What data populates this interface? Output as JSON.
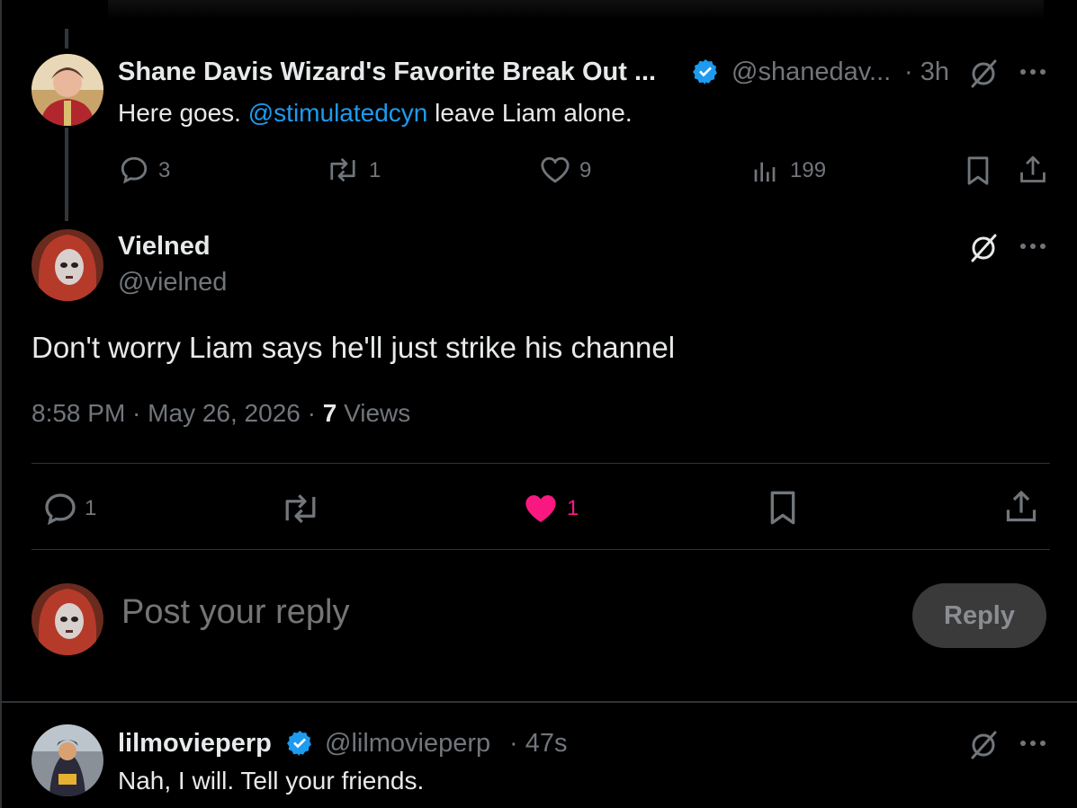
{
  "colors": {
    "accent": "#1d9bf0",
    "like": "#f91880",
    "muted": "#71767b",
    "text": "#e7e9ea"
  },
  "parent_post": {
    "display_name": "Shane Davis Wizard's Favorite Break Out ...",
    "handle": "@shanedav...",
    "time": "· 3h",
    "verified": true,
    "text_before": "Here goes. ",
    "mention": "@stimulatedcyn",
    "text_after": " leave Liam alone.",
    "reply_count": "3",
    "repost_count": "1",
    "like_count": "9",
    "view_count": "199"
  },
  "main_post": {
    "display_name": "Vielned",
    "handle": "@vielned",
    "text": "Don't worry Liam says he'll just strike his channel",
    "time": "8:58 PM",
    "date": "May 26, 2026",
    "views_count": "7",
    "views_label": "Views",
    "reply_count": "1",
    "like_count": "1"
  },
  "composer": {
    "placeholder": "Post your reply",
    "button_label": "Reply"
  },
  "reply_post": {
    "display_name": "lilmovieperp",
    "handle": "@lilmovieperp",
    "time": "· 47s",
    "verified": true,
    "text": "Nah, I will. Tell your friends."
  },
  "icons": [
    "reply-icon",
    "repost-icon",
    "like-icon",
    "views-icon",
    "bookmark-icon",
    "share-icon",
    "grok-icon",
    "more-icon",
    "verified-icon"
  ]
}
